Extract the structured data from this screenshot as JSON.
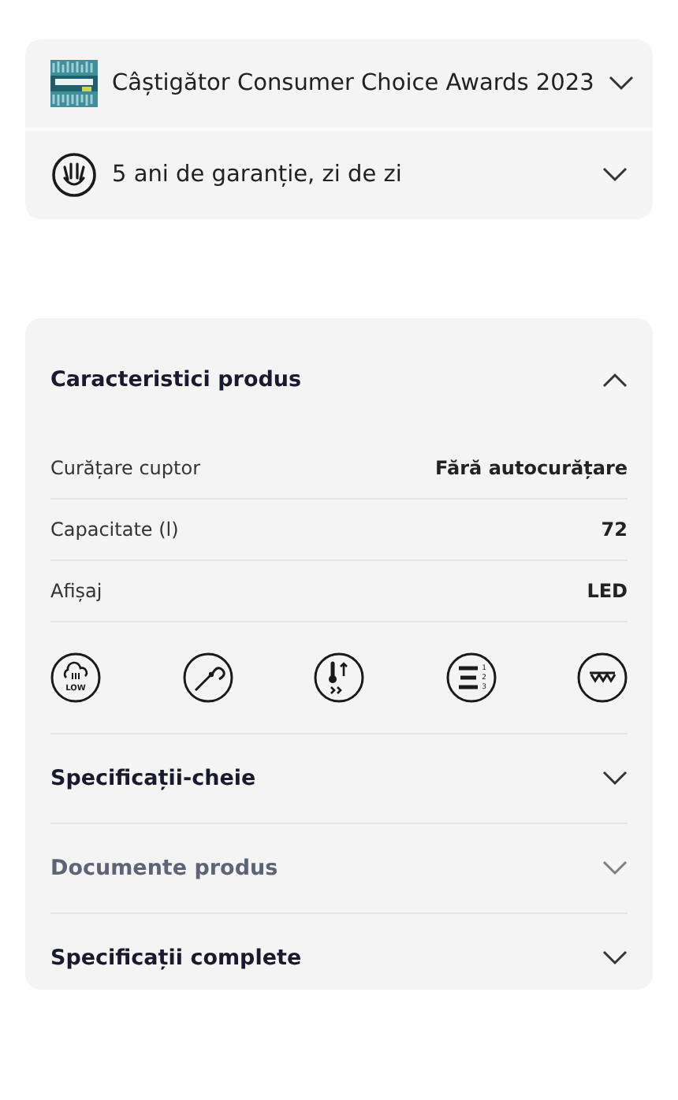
{
  "highlights": [
    {
      "kind": "award",
      "label": "Câștigător Consumer Choice Awards 2023",
      "expanded": false
    },
    {
      "kind": "warranty",
      "label": "5 ani de garanție, zi de zi",
      "expanded": false
    }
  ],
  "features": {
    "title": "Caracteristici produs",
    "expanded": true,
    "specs": [
      {
        "label": "Curățare cuptor",
        "value": "Fără autocurățare"
      },
      {
        "label": "Capacitate (l)",
        "value": "72"
      },
      {
        "label": "Afișaj",
        "value": "LED"
      }
    ],
    "icons": [
      {
        "kind": "steam",
        "label": "LOW"
      },
      {
        "kind": "probe"
      },
      {
        "kind": "thermo"
      },
      {
        "kind": "levels",
        "labels": [
          "1",
          "2",
          "3"
        ]
      },
      {
        "kind": "grill"
      }
    ]
  },
  "sections": [
    {
      "label": "Specificații-cheie",
      "expanded": false,
      "disabled": false
    },
    {
      "label": "Documente produs",
      "expanded": false,
      "disabled": true
    },
    {
      "label": "Specificații complete",
      "expanded": false,
      "disabled": false
    }
  ]
}
